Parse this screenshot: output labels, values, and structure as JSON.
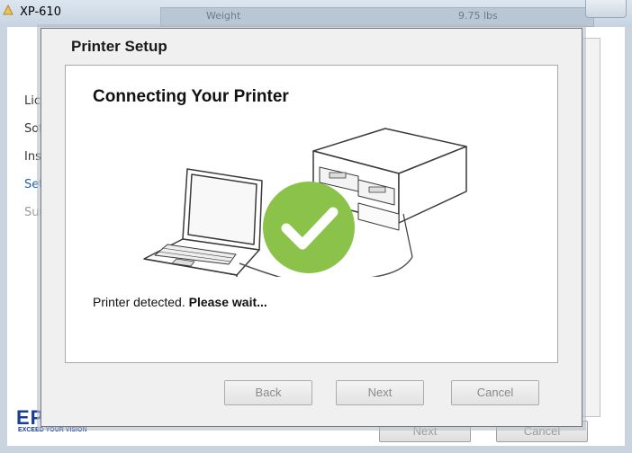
{
  "background_window": {
    "title": "XP-610",
    "strip": [
      "Weight",
      "9.75 lbs"
    ],
    "steps": [
      {
        "label": "Lic",
        "state": "normal"
      },
      {
        "label": "Sof",
        "state": "normal"
      },
      {
        "label": "Ins",
        "state": "normal"
      },
      {
        "label": "Set",
        "state": "active"
      },
      {
        "label": "Sur",
        "state": "disabled"
      }
    ],
    "logo": "EP",
    "tagline": "EXCEED YOUR VISION",
    "buttons": {
      "next": "Next",
      "cancel": "Cancel"
    }
  },
  "dialog": {
    "title": "Printer Setup",
    "heading": "Connecting Your Printer",
    "status_text": "Printer detected. ",
    "status_bold": "Please wait...",
    "buttons": {
      "back": "Back",
      "next": "Next",
      "cancel": "Cancel"
    }
  },
  "colors": {
    "accent": "#1f5fa8",
    "checkmark": "#8bc34a",
    "logo": "#1a3d9a"
  },
  "icons": {
    "illustration": "laptop-printer-connected",
    "status": "checkmark-circle-icon"
  }
}
